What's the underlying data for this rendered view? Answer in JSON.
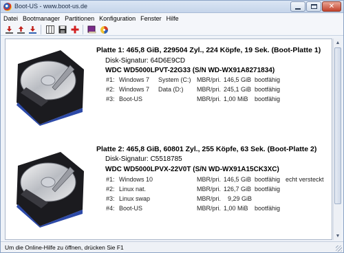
{
  "window": {
    "title": "Boot-US - www.boot-us.de",
    "close_glyph": "✕"
  },
  "menu": [
    "Datei",
    "Bootmanager",
    "Partitionen",
    "Konfiguration",
    "Fenster",
    "Hilfe"
  ],
  "toolbar": {
    "icons": [
      "boot-red-icon",
      "boot-red-icon",
      "boot-red-icon",
      "grid-icon",
      "save-disk-icon",
      "red-cross-icon",
      "book-icon",
      "color-disc-icon"
    ]
  },
  "disks": [
    {
      "header": "Platte 1:  465,8 GiB,  229504 Zyl., 224 Köpfe, 19 Sek. (Boot-Platte 1)",
      "signature": "Disk-Signatur:  64D6E9CD",
      "model": "WDC WD5000LPVT-22G33    (S/N WD-WX91A8271834)",
      "partitions": [
        {
          "num": "#1:",
          "os": "Windows 7",
          "label": "System (C:)",
          "type": "MBR/pri.",
          "size": "146,5 GiB",
          "boot": "bootfähig",
          "extra": ""
        },
        {
          "num": "#2:",
          "os": "Windows 7",
          "label": "Data (D:)",
          "type": "MBR/pri.",
          "size": "245,1 GiB",
          "boot": "bootfähig",
          "extra": ""
        },
        {
          "num": "#3:",
          "os": "Boot-US",
          "label": "",
          "type": "MBR/pri.",
          "size": "1,00 MiB",
          "boot": "bootfähig",
          "extra": ""
        }
      ]
    },
    {
      "header": "Platte 2:  465,8 GiB,  60801 Zyl., 255 Köpfe, 63 Sek. (Boot-Platte 2)",
      "signature": "Disk-Signatur:  C5518785",
      "model": "WDC WD5000LPVX-22V0T    (S/N WD-WX91A15CK3XC)",
      "partitions": [
        {
          "num": "#1:",
          "os": "Windows 10",
          "label": "",
          "type": "MBR/pri.",
          "size": "146,5 GiB",
          "boot": "bootfähig",
          "extra": "echt versteckt"
        },
        {
          "num": "#2:",
          "os": "Linux nat.",
          "label": "",
          "type": "MBR/pri.",
          "size": "126,7 GiB",
          "boot": "bootfähig",
          "extra": ""
        },
        {
          "num": "#3:",
          "os": "Linux swap",
          "label": "",
          "type": "MBR/pri.",
          "size": "9,29 GiB",
          "boot": "",
          "extra": ""
        },
        {
          "num": "#4:",
          "os": "Boot-US",
          "label": "",
          "type": "MBR/pri.",
          "size": "1,00 MiB",
          "boot": "bootfähig",
          "extra": ""
        }
      ]
    }
  ],
  "status": "Um die Online-Hilfe zu öffnen, drücken Sie F1"
}
